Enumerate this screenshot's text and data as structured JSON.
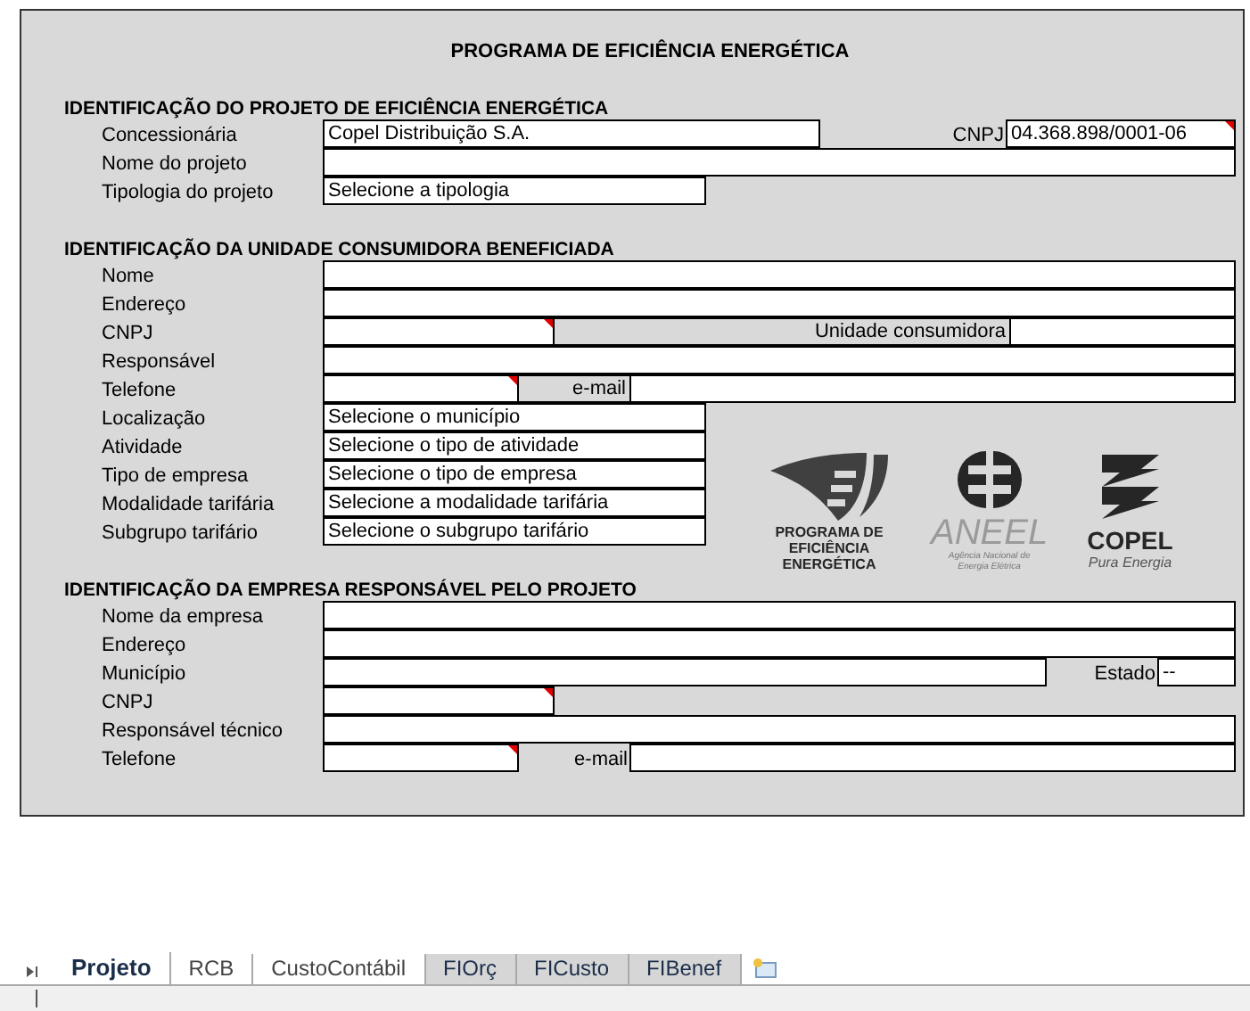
{
  "title": "PROGRAMA DE EFICIÊNCIA ENERGÉTICA",
  "sections": [
    {
      "heading": "IDENTIFICAÇÃO DO PROJETO DE EFICIÊNCIA ENERGÉTICA",
      "rows": [
        {
          "kind": "concession",
          "label": "Concessionária",
          "fields": [
            {
              "kind": "input",
              "value": "Copel Distribuição S.A.",
              "comment": false
            },
            {
              "kind": "caption",
              "value": "CNPJ",
              "boxed": false
            },
            {
              "kind": "input",
              "value": "04.368.898/0001-06",
              "comment": true
            }
          ]
        },
        {
          "kind": "full",
          "label": "Nome do projeto",
          "fields": [
            {
              "kind": "input",
              "comment": false
            }
          ]
        },
        {
          "kind": "select",
          "label": "Tipologia do projeto",
          "fields": [
            {
              "kind": "input",
              "value": "Selecione a tipologia",
              "comment": false
            }
          ]
        }
      ]
    },
    {
      "heading": "IDENTIFICAÇÃO DA UNIDADE CONSUMIDORA BENEFICIADA",
      "rows": [
        {
          "kind": "full",
          "label": "Nome",
          "fields": [
            {
              "kind": "input",
              "comment": false
            }
          ]
        },
        {
          "kind": "full",
          "label": "Endereço",
          "fields": [
            {
              "kind": "input",
              "comment": false
            }
          ]
        },
        {
          "kind": "unit",
          "label": "CNPJ",
          "fields": [
            {
              "kind": "input",
              "comment": true
            },
            {
              "kind": "caption",
              "value": "Unidade consumidora",
              "boxed": true
            },
            {
              "kind": "input",
              "comment": false
            }
          ]
        },
        {
          "kind": "full",
          "label": "Responsável",
          "fields": [
            {
              "kind": "input",
              "comment": false
            }
          ]
        },
        {
          "kind": "phone",
          "label": "Telefone",
          "fields": [
            {
              "kind": "input",
              "comment": true
            },
            {
              "kind": "caption",
              "value": "e-mail",
              "boxed": true
            },
            {
              "kind": "input",
              "comment": false
            }
          ]
        },
        {
          "kind": "select",
          "label": "Localização",
          "fields": [
            {
              "kind": "input",
              "value": "Selecione o município",
              "comment": false
            }
          ]
        },
        {
          "kind": "select",
          "label": "Atividade",
          "fields": [
            {
              "kind": "input",
              "value": "Selecione o tipo de atividade",
              "comment": false
            }
          ]
        },
        {
          "kind": "select",
          "label": "Tipo de empresa",
          "fields": [
            {
              "kind": "input",
              "value": "Selecione o tipo de empresa",
              "comment": false
            }
          ]
        },
        {
          "kind": "select",
          "label": "Modalidade tarifária",
          "fields": [
            {
              "kind": "input",
              "value": "Selecione a modalidade tarifária",
              "comment": false
            }
          ]
        },
        {
          "kind": "select",
          "label": "Subgrupo tarifário",
          "fields": [
            {
              "kind": "input",
              "value": "Selecione o subgrupo tarifário",
              "comment": false
            }
          ]
        }
      ],
      "logos": [
        {
          "kind": "pee",
          "lines": [
            "PROGRAMA DE",
            "EFICIÊNCIA",
            "ENERGÉTICA"
          ]
        },
        {
          "kind": "aneel",
          "name": "ANEEL",
          "lines": [
            "Agência Nacional de",
            "Energia Elétrica"
          ]
        },
        {
          "kind": "copel",
          "name": "COPEL",
          "lines": [
            "Pura Energia"
          ]
        }
      ]
    },
    {
      "heading": "IDENTIFICAÇÃO DA EMPRESA RESPONSÁVEL PELO PROJETO",
      "rows": [
        {
          "kind": "full",
          "label": "Nome da empresa",
          "fields": [
            {
              "kind": "input",
              "comment": false
            }
          ]
        },
        {
          "kind": "full",
          "label": "Endereço",
          "fields": [
            {
              "kind": "input",
              "comment": false
            }
          ]
        },
        {
          "kind": "city",
          "label": "Município",
          "fields": [
            {
              "kind": "input",
              "comment": false
            },
            {
              "kind": "caption",
              "value": "Estado",
              "boxed": false
            },
            {
              "kind": "input",
              "value": "--",
              "comment": false
            }
          ]
        },
        {
          "kind": "short",
          "label": "CNPJ",
          "fields": [
            {
              "kind": "input",
              "comment": true
            }
          ]
        },
        {
          "kind": "full",
          "label": "Responsável técnico",
          "fields": [
            {
              "kind": "input",
              "comment": false
            }
          ]
        },
        {
          "kind": "phone",
          "label": "Telefone",
          "fields": [
            {
              "kind": "input",
              "comment": true
            },
            {
              "kind": "caption",
              "value": "e-mail",
              "boxed": false
            },
            {
              "kind": "input",
              "comment": false
            }
          ]
        }
      ]
    }
  ],
  "sheet_tabs": [
    {
      "label": "Projeto",
      "selected": true,
      "shaded": false
    },
    {
      "label": "RCB",
      "selected": false,
      "shaded": false
    },
    {
      "label": "CustoContábil",
      "selected": false,
      "shaded": false
    },
    {
      "label": "FIOrç",
      "selected": false,
      "shaded": true
    },
    {
      "label": "FICusto",
      "selected": false,
      "shaded": true
    },
    {
      "label": "FIBenef",
      "selected": false,
      "shaded": true
    }
  ]
}
